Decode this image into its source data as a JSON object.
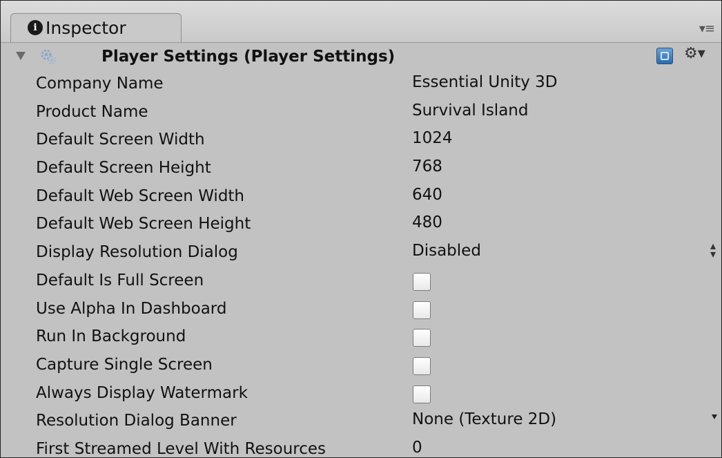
{
  "tab": {
    "label": "Inspector",
    "info_glyph": "i"
  },
  "component": {
    "title": "Player Settings (Player Settings)"
  },
  "properties": [
    {
      "label": "Company Name",
      "value": "Essential Unity 3D"
    },
    {
      "label": "Product Name",
      "value": "Survival Island"
    },
    {
      "label": "Default Screen Width",
      "value": "1024"
    },
    {
      "label": "Default Screen Height",
      "value": "768"
    },
    {
      "label": "Default Web Screen Width",
      "value": "640"
    },
    {
      "label": "Default Web Screen Height",
      "value": "480"
    },
    {
      "label": "Display Resolution Dialog",
      "value": "Disabled"
    },
    {
      "label": "Default Is Full Screen",
      "checked": false
    },
    {
      "label": "Use Alpha In Dashboard",
      "checked": false
    },
    {
      "label": "Run In Background",
      "checked": false
    },
    {
      "label": "Capture Single Screen",
      "checked": false
    },
    {
      "label": "Always Display Watermark",
      "checked": false
    },
    {
      "label": "Resolution Dialog Banner",
      "value": "None (Texture 2D)"
    },
    {
      "label": "First Streamed Level With Resources",
      "value": "0"
    }
  ]
}
